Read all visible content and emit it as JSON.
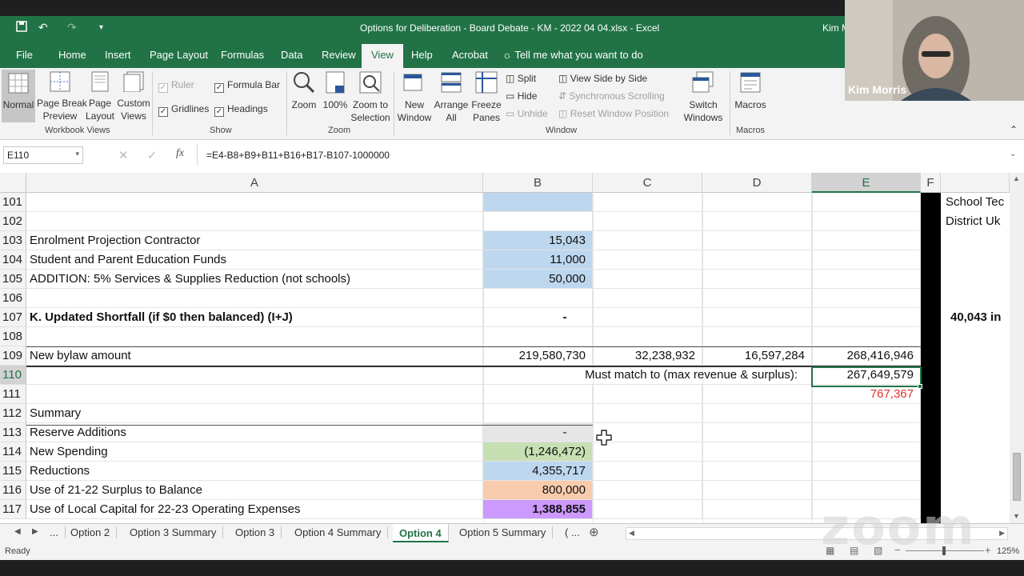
{
  "titlebar": {
    "title": "Options for Deliberation - Board Debate - KM - 2022 04 04.xlsx  -  Excel",
    "user": "Kim M"
  },
  "menu": {
    "tabs": [
      "File",
      "Home",
      "Insert",
      "Page Layout",
      "Formulas",
      "Data",
      "Review",
      "View",
      "Help",
      "Acrobat"
    ],
    "active": "View",
    "tell_me": "Tell me what you want to do"
  },
  "ribbon": {
    "workbook_views": {
      "normal": "Normal",
      "page_break": "Page Break\nPreview",
      "page_layout": "Page\nLayout",
      "custom_views": "Custom\nViews",
      "group": "Workbook Views"
    },
    "show": {
      "ruler": "Ruler",
      "formula_bar": "Formula Bar",
      "gridlines": "Gridlines",
      "headings": "Headings",
      "group": "Show"
    },
    "zoom": {
      "zoom": "Zoom",
      "hundred": "100%",
      "zoom_sel": "Zoom to\nSelection",
      "group": "Zoom"
    },
    "window": {
      "new_window": "New\nWindow",
      "arrange_all": "Arrange\nAll",
      "freeze": "Freeze\nPanes",
      "split": "Split",
      "hide": "Hide",
      "unhide": "Unhide",
      "side_by_side": "View Side by Side",
      "sync_scroll": "Synchronous Scrolling",
      "reset_pos": "Reset Window Position",
      "switch": "Switch\nWindows",
      "group": "Window"
    },
    "macros": {
      "macros": "Macros",
      "group": "Macros"
    }
  },
  "formula_bar": {
    "name_box": "E110",
    "fx": "fx",
    "formula": "=E4-B8+B9+B11+B16+B17-B107-1000000"
  },
  "columns": [
    "A",
    "B",
    "C",
    "D",
    "E",
    "F"
  ],
  "rows": [
    {
      "num": "101",
      "A": "",
      "B": "",
      "C": "",
      "D": "",
      "E": ""
    },
    {
      "num": "102",
      "A": "",
      "B": "",
      "C": "",
      "D": "",
      "E": ""
    },
    {
      "num": "103",
      "A": "Enrolment Projection Contractor",
      "B": "15,043",
      "C": "",
      "D": "",
      "E": ""
    },
    {
      "num": "104",
      "A": "Student and Parent Education Funds",
      "B": "11,000",
      "C": "",
      "D": "",
      "E": ""
    },
    {
      "num": "105",
      "A": "ADDITION:  5% Services & Supplies Reduction (not schools)",
      "B": "50,000",
      "C": "",
      "D": "",
      "E": ""
    },
    {
      "num": "106",
      "A": "",
      "B": "",
      "C": "",
      "D": "",
      "E": ""
    },
    {
      "num": "107",
      "A": "K.  Updated Shortfall (if $0 then balanced) (I+J)",
      "B": "-",
      "C": "",
      "D": "",
      "E": ""
    },
    {
      "num": "108",
      "A": "",
      "B": "",
      "C": "",
      "D": "",
      "E": ""
    },
    {
      "num": "109",
      "A": "New bylaw amount",
      "B": "219,580,730",
      "C": "32,238,932",
      "D": "16,597,284",
      "E": "268,416,946"
    },
    {
      "num": "110",
      "A": "",
      "B": "",
      "C": "",
      "D": "",
      "E": "267,649,579"
    },
    {
      "num": "111",
      "A": "",
      "B": "",
      "C": "",
      "D": "",
      "E": "767,367"
    },
    {
      "num": "112",
      "A": "Summary",
      "B": "",
      "C": "",
      "D": "",
      "E": ""
    },
    {
      "num": "113",
      "A": "Reserve Additions",
      "B": "-",
      "C": "",
      "D": "",
      "E": ""
    },
    {
      "num": "114",
      "A": "New Spending",
      "B": "(1,246,472)",
      "C": "",
      "D": "",
      "E": ""
    },
    {
      "num": "115",
      "A": "Reductions",
      "B": "4,355,717",
      "C": "",
      "D": "",
      "E": ""
    },
    {
      "num": "116",
      "A": "Use of 21-22 Surplus to Balance",
      "B": "800,000",
      "C": "",
      "D": "",
      "E": ""
    },
    {
      "num": "117",
      "A": "Use of Local Capital for 22-23 Operating Expenses",
      "B": "1,388,855",
      "C": "",
      "D": "",
      "E": ""
    }
  ],
  "must_match": "Must match to (max revenue & surplus):",
  "side_text": {
    "line1": "School Tec",
    "line2": "District Uk",
    "line3": "40,043 in"
  },
  "sheets": {
    "nav_more": "...",
    "tabs": [
      "Option 2",
      "Option 3 Summary",
      "Option 3",
      "Option 4 Summary",
      "Option 4",
      "Option 5 Summary",
      "( ..."
    ],
    "active": "Option 4"
  },
  "status": {
    "ready": "Ready",
    "zoom": "125%"
  },
  "video": {
    "name": "Kim Morris",
    "watermark": "zoom"
  },
  "colors": {
    "excel_green": "#217346",
    "fill_blue": "#bdd7ee",
    "fill_green": "#c6e0b4",
    "fill_orange": "#f8cbad",
    "fill_purple": "#cc99ff",
    "fill_grey": "#e7e6e6",
    "red_text": "#e03030"
  }
}
